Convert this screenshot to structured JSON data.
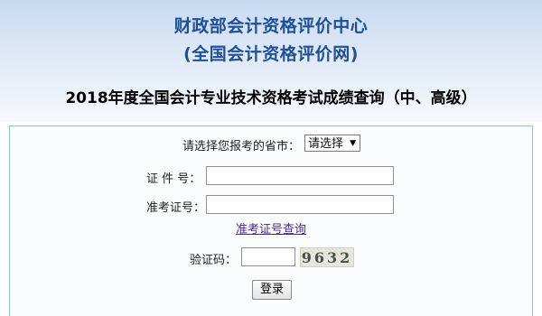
{
  "header": {
    "org_name": "财政部会计资格评价中心",
    "org_subtitle": "(全国会计资格评价网)",
    "page_title": "2018年度全国会计专业技术资格考试成绩查询（中、高级）"
  },
  "form": {
    "province": {
      "label": "请选择您报考的省市：",
      "selected": "请选择"
    },
    "id_number": {
      "label": "证 件 号：",
      "value": ""
    },
    "admission_number": {
      "label": "准考证号：",
      "value": ""
    },
    "lookup_link": "准考证号查询",
    "captcha": {
      "label": "验证码：",
      "value": "",
      "image_text": "9632"
    },
    "submit_label": "登录"
  },
  "colors": {
    "header_gradient_top": "#c6daf1",
    "org_title": "#1f4f95",
    "link": "#4b2a8a",
    "form_border": "#9cc7b0"
  }
}
